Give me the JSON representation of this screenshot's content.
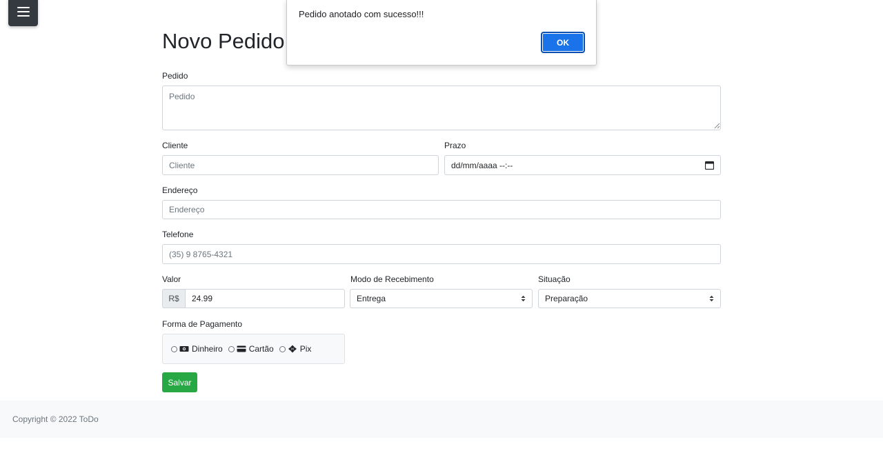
{
  "nav": {
    "menu_icon": "hamburger-menu-icon"
  },
  "page": {
    "title": "Novo Pedido"
  },
  "form": {
    "pedido": {
      "label": "Pedido",
      "placeholder": "Pedido",
      "value": ""
    },
    "cliente": {
      "label": "Cliente",
      "placeholder": "Cliente",
      "value": ""
    },
    "prazo": {
      "label": "Prazo",
      "value": "dd/mm/aaaa --:--",
      "icon": "calendar-icon"
    },
    "endereco": {
      "label": "Endereço",
      "placeholder": "Endereço",
      "value": ""
    },
    "telefone": {
      "label": "Telefone",
      "placeholder": "(35) 9 8765-4321",
      "value": ""
    },
    "valor": {
      "label": "Valor",
      "prefix": "R$",
      "value": "24.99"
    },
    "modo_recebimento": {
      "label": "Modo de Recebimento",
      "selected": "Entrega"
    },
    "situacao": {
      "label": "Situação",
      "selected": "Preparação"
    },
    "forma_pagamento": {
      "label": "Forma de Pagamento",
      "options": [
        {
          "label": "Dinheiro",
          "icon": "money-bill-icon"
        },
        {
          "label": "Cartão",
          "icon": "credit-card-icon"
        },
        {
          "label": "Pix",
          "icon": "pix-icon"
        }
      ]
    },
    "save_label": "Salvar"
  },
  "footer": {
    "text": "Copyright © 2022 ToDo"
  },
  "alert": {
    "message": "Pedido anotado com sucesso!!!",
    "ok_label": "OK"
  },
  "colors": {
    "primary": "#1a73e8",
    "success": "#28a745",
    "dark": "#343a40",
    "footer_bg": "#f8f9fa"
  }
}
